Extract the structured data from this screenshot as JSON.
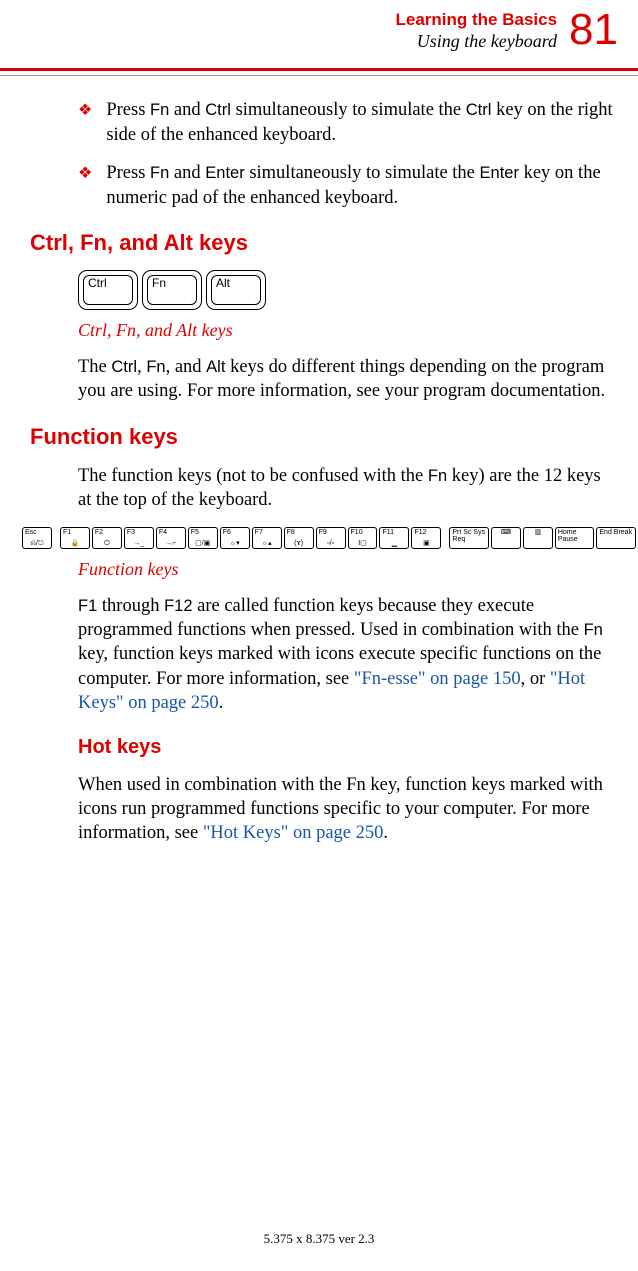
{
  "header": {
    "chapter": "Learning the Basics",
    "section": "Using the keyboard",
    "page_number": "81"
  },
  "bullets": [
    {
      "text_parts": [
        "Press ",
        "Fn",
        " and ",
        "Ctrl",
        " simultaneously to simulate the ",
        "Ctrl",
        " key on the right side of the enhanced keyboard."
      ]
    },
    {
      "text_parts": [
        "Press ",
        "Fn",
        " and ",
        "Enter",
        " simultaneously to simulate the ",
        "Enter",
        " key on the numeric pad of the enhanced keyboard."
      ]
    }
  ],
  "section1": {
    "heading": "Ctrl, Fn, and Alt keys",
    "keys": [
      "Ctrl",
      "Fn",
      "Alt"
    ],
    "caption": "Ctrl, Fn, and Alt keys",
    "para_parts": [
      "The ",
      "Ctrl",
      ", ",
      "Fn",
      ", and ",
      "Alt",
      " keys do different things depending on the program you are using. For more information, see your program documentation."
    ]
  },
  "section2": {
    "heading": "Function keys",
    "intro_parts": [
      "The function keys (not to be confused with the ",
      "Fn",
      " key) are the 12 keys at the top of the keyboard."
    ],
    "fkey_labels": [
      "Esc",
      "F1",
      "F2",
      "F3",
      "F4",
      "F5",
      "F6",
      "F7",
      "F8",
      "F9",
      "F10",
      "F11",
      "F12",
      "Prt Sc Sys Req",
      "",
      "",
      "Home Pause",
      "End Break"
    ],
    "caption": "Function keys",
    "para_parts": [
      "F1",
      " through ",
      "F12",
      " are called function keys because they execute programmed functions when pressed. Used in combination with the ",
      "Fn",
      " key, function keys marked with icons execute specific functions on the computer. For more information, see "
    ],
    "link1": "\"Fn-esse\" on page 150",
    "mid": ", or ",
    "link2": "\"Hot Keys\" on page 250",
    "end": "."
  },
  "section3": {
    "heading": "Hot keys",
    "para_pre": "When used in combination with the Fn key, function keys marked with icons run programmed functions specific to your computer. For more information, see ",
    "link": "\"Hot Keys\" on page 250",
    "end": "."
  },
  "footer": "5.375 x 8.375 ver 2.3"
}
